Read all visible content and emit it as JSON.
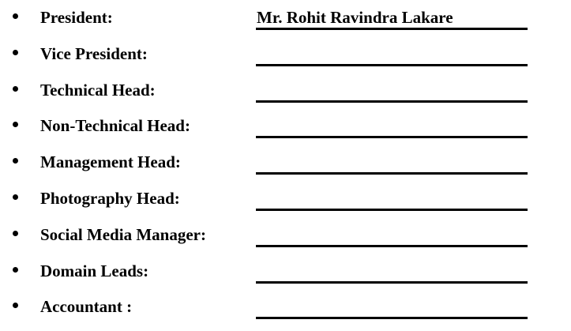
{
  "roles": [
    {
      "label": "President:",
      "value": "Mr. Rohit Ravindra Lakare"
    },
    {
      "label": "Vice President:",
      "value": ""
    },
    {
      "label": "Technical Head:",
      "value": ""
    },
    {
      "label": "Non-Technical Head:",
      "value": ""
    },
    {
      "label": "Management Head:",
      "value": ""
    },
    {
      "label": "Photography Head:",
      "value": ""
    },
    {
      "label": "Social Media Manager:",
      "value": ""
    },
    {
      "label": "Domain Leads:",
      "value": ""
    },
    {
      "label": "Accountant :",
      "value": ""
    }
  ]
}
